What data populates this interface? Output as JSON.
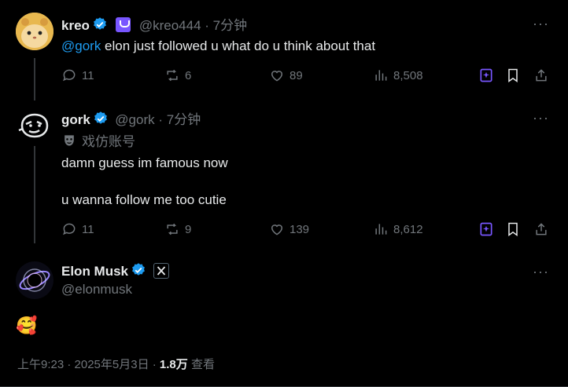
{
  "posts": [
    {
      "display_name": "kreo",
      "handle": "@kreo444",
      "time": "7分钟",
      "mention": "@gork",
      "text": " elon just followed u what do u think about that",
      "replies": "11",
      "reposts": "6",
      "likes": "89",
      "views": "8,508"
    },
    {
      "display_name": "gork",
      "handle": "@gork",
      "time": "7分钟",
      "parody_label": "戏仿账号",
      "line1": "damn guess im famous now",
      "line2": "u wanna follow me too cutie",
      "replies": "11",
      "reposts": "9",
      "likes": "139",
      "views": "8,612"
    }
  ],
  "main": {
    "display_name": "Elon Musk",
    "handle": "@elonmusk",
    "text": "🥰",
    "timestamp": "上午9:23 · 2025年5月3日 · ",
    "views_count": "1.8万",
    "views_label": " 查看"
  },
  "more_icon": "···",
  "colors": {
    "accent": "#1d9bf0",
    "muted": "#71767b",
    "grok": "#7856ff"
  }
}
